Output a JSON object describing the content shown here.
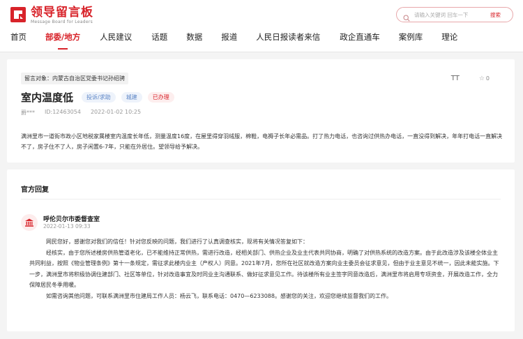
{
  "brand": {
    "name": "领导留言板",
    "subtitle": "Message Board for Leaders",
    "color": "#d8232a"
  },
  "search": {
    "placeholder": "请输入关键词 回车一下",
    "button_label": "搜索"
  },
  "nav": {
    "items": [
      {
        "label": "首页"
      },
      {
        "label": "部委/地方",
        "active": true
      },
      {
        "label": "人民建议"
      },
      {
        "label": "话题"
      },
      {
        "label": "数据"
      },
      {
        "label": "报道"
      },
      {
        "label": "人民日报读者来信"
      },
      {
        "label": "政企直通车"
      },
      {
        "label": "案例库"
      },
      {
        "label": "理论"
      }
    ]
  },
  "message": {
    "target": "留言对象：内蒙古自治区党委书记孙绍骋",
    "font_size_icon": "TT",
    "favorite_count": "0",
    "title": "室内温度低",
    "tags": {
      "type": "投诉/求助",
      "domain": "城建",
      "status": "已办理"
    },
    "author": "爵***",
    "id": "ID:12463054",
    "time": "2022-01-02 10:25",
    "body": "满洲里市一道街市政小区地税家属楼室内温度长年低，测量温度16度，在屋里得穿羽绒服，棉鞋，电褥子长年必需品。打了热力电话，也咨询过供热办电话，一直没得到解决，年年打电话一直解决不了，房子住不了人，房子闲置6-7年，只能在外居住。望领导给予解决。"
  },
  "reply": {
    "heading": "官方回复",
    "org_name": "呼伦贝尔市委督查室",
    "date": "2022-01-13 09:33",
    "paragraphs": [
      "网民您好，感谢您对我们的信任！针对您反映的问题，我们进行了认真调查核实，现将有关情况答复如下：",
      "经核实，由于您所述楼房供热管道老化，已不能维持正常供热，需进行改造，经相关部门、供热企业及业主代表共同协商，明确了对供热系统的改造方案。由于此改造涉及该楼全体业主共同利益，按照《物业管理条例》第十一条规定，需征求此楼内业主（产权人）同意。2021年7月，您所在社区就改造方案向业主委员会征求意见，但由于业主意见不统一，因此未能实施。下一步，满洲里市将积极协调住建部门、社区等单位，针对改造事宜及时同业主沟通联系、做好征求意见工作。待该楼所有业主签字同意改造后，满洲里市将启用专项资金，开展改造工作，全力保障居民冬季用暖。",
      "如需咨询其他问题，可联系满洲里市住建局工作人员：杨云飞，联系电话：0470—6233088。感谢您的关注，欢迎您继续监督我们的工作。"
    ]
  }
}
